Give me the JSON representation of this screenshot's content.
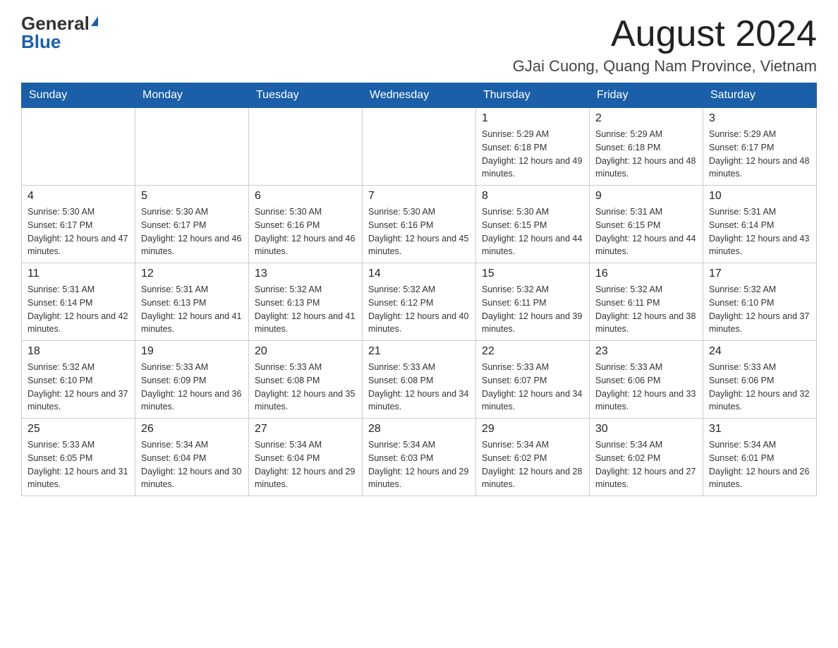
{
  "header": {
    "logo_general": "General",
    "logo_blue": "Blue",
    "month_title": "August 2024",
    "location": "GJai Cuong, Quang Nam Province, Vietnam"
  },
  "weekdays": [
    "Sunday",
    "Monday",
    "Tuesday",
    "Wednesday",
    "Thursday",
    "Friday",
    "Saturday"
  ],
  "weeks": [
    [
      {
        "day": "",
        "sunrise": "",
        "sunset": "",
        "daylight": ""
      },
      {
        "day": "",
        "sunrise": "",
        "sunset": "",
        "daylight": ""
      },
      {
        "day": "",
        "sunrise": "",
        "sunset": "",
        "daylight": ""
      },
      {
        "day": "",
        "sunrise": "",
        "sunset": "",
        "daylight": ""
      },
      {
        "day": "1",
        "sunrise": "Sunrise: 5:29 AM",
        "sunset": "Sunset: 6:18 PM",
        "daylight": "Daylight: 12 hours and 49 minutes."
      },
      {
        "day": "2",
        "sunrise": "Sunrise: 5:29 AM",
        "sunset": "Sunset: 6:18 PM",
        "daylight": "Daylight: 12 hours and 48 minutes."
      },
      {
        "day": "3",
        "sunrise": "Sunrise: 5:29 AM",
        "sunset": "Sunset: 6:17 PM",
        "daylight": "Daylight: 12 hours and 48 minutes."
      }
    ],
    [
      {
        "day": "4",
        "sunrise": "Sunrise: 5:30 AM",
        "sunset": "Sunset: 6:17 PM",
        "daylight": "Daylight: 12 hours and 47 minutes."
      },
      {
        "day": "5",
        "sunrise": "Sunrise: 5:30 AM",
        "sunset": "Sunset: 6:17 PM",
        "daylight": "Daylight: 12 hours and 46 minutes."
      },
      {
        "day": "6",
        "sunrise": "Sunrise: 5:30 AM",
        "sunset": "Sunset: 6:16 PM",
        "daylight": "Daylight: 12 hours and 46 minutes."
      },
      {
        "day": "7",
        "sunrise": "Sunrise: 5:30 AM",
        "sunset": "Sunset: 6:16 PM",
        "daylight": "Daylight: 12 hours and 45 minutes."
      },
      {
        "day": "8",
        "sunrise": "Sunrise: 5:30 AM",
        "sunset": "Sunset: 6:15 PM",
        "daylight": "Daylight: 12 hours and 44 minutes."
      },
      {
        "day": "9",
        "sunrise": "Sunrise: 5:31 AM",
        "sunset": "Sunset: 6:15 PM",
        "daylight": "Daylight: 12 hours and 44 minutes."
      },
      {
        "day": "10",
        "sunrise": "Sunrise: 5:31 AM",
        "sunset": "Sunset: 6:14 PM",
        "daylight": "Daylight: 12 hours and 43 minutes."
      }
    ],
    [
      {
        "day": "11",
        "sunrise": "Sunrise: 5:31 AM",
        "sunset": "Sunset: 6:14 PM",
        "daylight": "Daylight: 12 hours and 42 minutes."
      },
      {
        "day": "12",
        "sunrise": "Sunrise: 5:31 AM",
        "sunset": "Sunset: 6:13 PM",
        "daylight": "Daylight: 12 hours and 41 minutes."
      },
      {
        "day": "13",
        "sunrise": "Sunrise: 5:32 AM",
        "sunset": "Sunset: 6:13 PM",
        "daylight": "Daylight: 12 hours and 41 minutes."
      },
      {
        "day": "14",
        "sunrise": "Sunrise: 5:32 AM",
        "sunset": "Sunset: 6:12 PM",
        "daylight": "Daylight: 12 hours and 40 minutes."
      },
      {
        "day": "15",
        "sunrise": "Sunrise: 5:32 AM",
        "sunset": "Sunset: 6:11 PM",
        "daylight": "Daylight: 12 hours and 39 minutes."
      },
      {
        "day": "16",
        "sunrise": "Sunrise: 5:32 AM",
        "sunset": "Sunset: 6:11 PM",
        "daylight": "Daylight: 12 hours and 38 minutes."
      },
      {
        "day": "17",
        "sunrise": "Sunrise: 5:32 AM",
        "sunset": "Sunset: 6:10 PM",
        "daylight": "Daylight: 12 hours and 37 minutes."
      }
    ],
    [
      {
        "day": "18",
        "sunrise": "Sunrise: 5:32 AM",
        "sunset": "Sunset: 6:10 PM",
        "daylight": "Daylight: 12 hours and 37 minutes."
      },
      {
        "day": "19",
        "sunrise": "Sunrise: 5:33 AM",
        "sunset": "Sunset: 6:09 PM",
        "daylight": "Daylight: 12 hours and 36 minutes."
      },
      {
        "day": "20",
        "sunrise": "Sunrise: 5:33 AM",
        "sunset": "Sunset: 6:08 PM",
        "daylight": "Daylight: 12 hours and 35 minutes."
      },
      {
        "day": "21",
        "sunrise": "Sunrise: 5:33 AM",
        "sunset": "Sunset: 6:08 PM",
        "daylight": "Daylight: 12 hours and 34 minutes."
      },
      {
        "day": "22",
        "sunrise": "Sunrise: 5:33 AM",
        "sunset": "Sunset: 6:07 PM",
        "daylight": "Daylight: 12 hours and 34 minutes."
      },
      {
        "day": "23",
        "sunrise": "Sunrise: 5:33 AM",
        "sunset": "Sunset: 6:06 PM",
        "daylight": "Daylight: 12 hours and 33 minutes."
      },
      {
        "day": "24",
        "sunrise": "Sunrise: 5:33 AM",
        "sunset": "Sunset: 6:06 PM",
        "daylight": "Daylight: 12 hours and 32 minutes."
      }
    ],
    [
      {
        "day": "25",
        "sunrise": "Sunrise: 5:33 AM",
        "sunset": "Sunset: 6:05 PM",
        "daylight": "Daylight: 12 hours and 31 minutes."
      },
      {
        "day": "26",
        "sunrise": "Sunrise: 5:34 AM",
        "sunset": "Sunset: 6:04 PM",
        "daylight": "Daylight: 12 hours and 30 minutes."
      },
      {
        "day": "27",
        "sunrise": "Sunrise: 5:34 AM",
        "sunset": "Sunset: 6:04 PM",
        "daylight": "Daylight: 12 hours and 29 minutes."
      },
      {
        "day": "28",
        "sunrise": "Sunrise: 5:34 AM",
        "sunset": "Sunset: 6:03 PM",
        "daylight": "Daylight: 12 hours and 29 minutes."
      },
      {
        "day": "29",
        "sunrise": "Sunrise: 5:34 AM",
        "sunset": "Sunset: 6:02 PM",
        "daylight": "Daylight: 12 hours and 28 minutes."
      },
      {
        "day": "30",
        "sunrise": "Sunrise: 5:34 AM",
        "sunset": "Sunset: 6:02 PM",
        "daylight": "Daylight: 12 hours and 27 minutes."
      },
      {
        "day": "31",
        "sunrise": "Sunrise: 5:34 AM",
        "sunset": "Sunset: 6:01 PM",
        "daylight": "Daylight: 12 hours and 26 minutes."
      }
    ]
  ]
}
